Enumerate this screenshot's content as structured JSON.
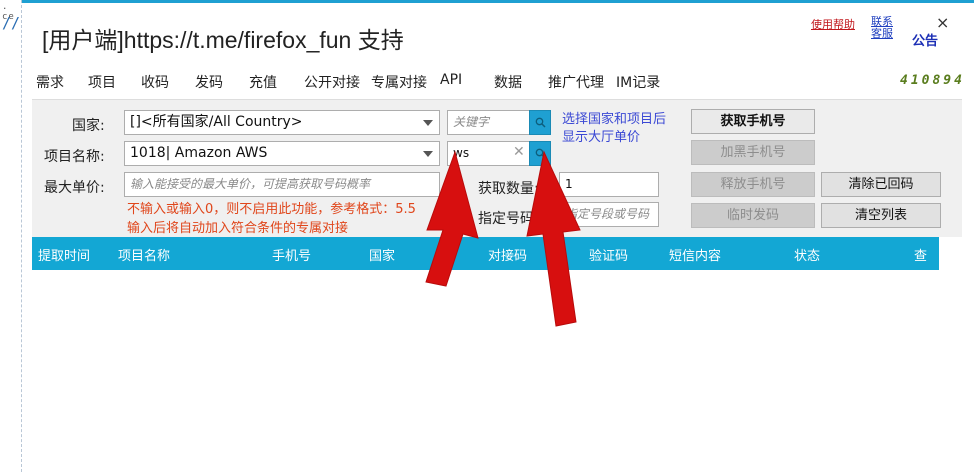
{
  "left_strip": {
    "dots": "  . ce",
    "slashes": "//"
  },
  "title": "[用户端]https://t.me/firefox_fun 支持",
  "top_links": {
    "help": "使用帮助",
    "kefu": "联系客服",
    "notice": "公告"
  },
  "close_symbol": "×",
  "tabs": [
    "需求",
    "项目",
    "收码",
    "发码",
    "充值",
    "公开对接",
    "专属对接",
    "API",
    "数据",
    "推广代理",
    "IM记录"
  ],
  "counter": "410894",
  "form": {
    "country_label": "国家:",
    "country_value": "[]<所有国家/All Country>",
    "keyword_placeholder": "关键字",
    "hint": "选择国家和项目后显示大厅单价",
    "project_label": "项目名称:",
    "project_value": "1018| Amazon AWS",
    "project_search_value": "ws",
    "max_price_label": "最大单价:",
    "max_price_placeholder": "输入能接受的最大单价，可提高获取号码概率",
    "quantity_label": "获取数量:",
    "quantity_value": "1",
    "specify_label": "指定号码:",
    "specify_placeholder": "指定号段或号码",
    "note_line1": "不输入或输入0，则不启用此功能，参考格式：5.5",
    "note_line2": "输入后将自动加入符合条件的专属对接"
  },
  "buttons": {
    "get_number": "获取手机号",
    "blacklist": "加黑手机号",
    "release": "释放手机号",
    "temp_send": "临时发码",
    "clear_received": "清除已回码",
    "clear_list": "清空列表"
  },
  "columns": [
    "提取时间",
    "项目名称",
    "手机号",
    "国家",
    "对接码",
    "验证码",
    "短信内容",
    "状态",
    "查"
  ],
  "colors": {
    "accent": "#13a7d4",
    "arrow": "#d70f0f",
    "counter": "#5a7d1e",
    "note": "#e0461b"
  }
}
